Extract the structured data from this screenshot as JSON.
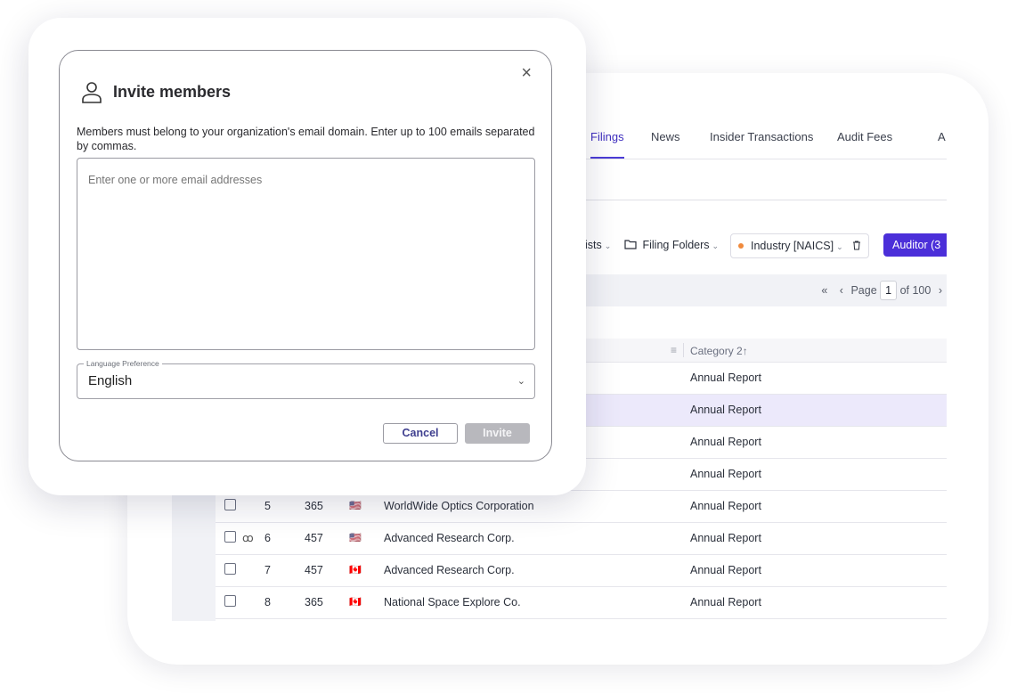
{
  "app": {
    "tabs": [
      {
        "label": "Filings",
        "active": true
      },
      {
        "label": "News",
        "active": false
      },
      {
        "label": "Insider Transactions",
        "active": false
      },
      {
        "label": "Audit Fees",
        "active": false
      },
      {
        "label": "A",
        "active": false
      }
    ],
    "filters": {
      "lists_partial": "ists",
      "filing_folders": "Filing Folders",
      "industry": "Industry [NAICS]",
      "auditor": "Auditor (3"
    },
    "pager": {
      "first": "«",
      "prev": "‹",
      "page_label": "Page",
      "current_page": "1",
      "of_label": "of 100",
      "next": "›"
    },
    "table": {
      "column_category": "Category 2↑",
      "rows": [
        {
          "num": "",
          "id": "",
          "flag": "",
          "company": "",
          "category": "Annual Report",
          "selected": false
        },
        {
          "num": "",
          "id": "",
          "flag": "",
          "company": "",
          "category": "Annual Report",
          "selected": true
        },
        {
          "num": "",
          "id": "",
          "flag": "",
          "company": "",
          "category": "Annual Report",
          "selected": false
        },
        {
          "num": "",
          "id": "",
          "flag": "",
          "company": "",
          "category": "Annual Report",
          "selected": false
        },
        {
          "num": "5",
          "id": "365",
          "flag": "🇺🇸",
          "company": "WorldWide Optics Corporation",
          "category": "Annual Report",
          "selected": false
        },
        {
          "num": "6",
          "id": "457",
          "flag": "🇺🇸",
          "company": "Advanced Research Corp.",
          "category": "Annual Report",
          "selected": false,
          "glasses": "ꝏ"
        },
        {
          "num": "7",
          "id": "457",
          "flag": "🇨🇦",
          "company": "Advanced Research Corp.",
          "category": "Annual Report",
          "selected": false
        },
        {
          "num": "8",
          "id": "365",
          "flag": "🇨🇦",
          "company": "National Space Explore Co.",
          "category": "Annual Report",
          "selected": false
        }
      ]
    }
  },
  "modal": {
    "title": "Invite members",
    "close_symbol": "×",
    "description": "Members must belong to your organization's email domain. Enter up to 100 emails separated by commas.",
    "email_placeholder": "Enter one or more email addresses",
    "language_label": "Language Preference",
    "language_value": "English",
    "cancel_label": "Cancel",
    "invite_label": "Invite"
  }
}
